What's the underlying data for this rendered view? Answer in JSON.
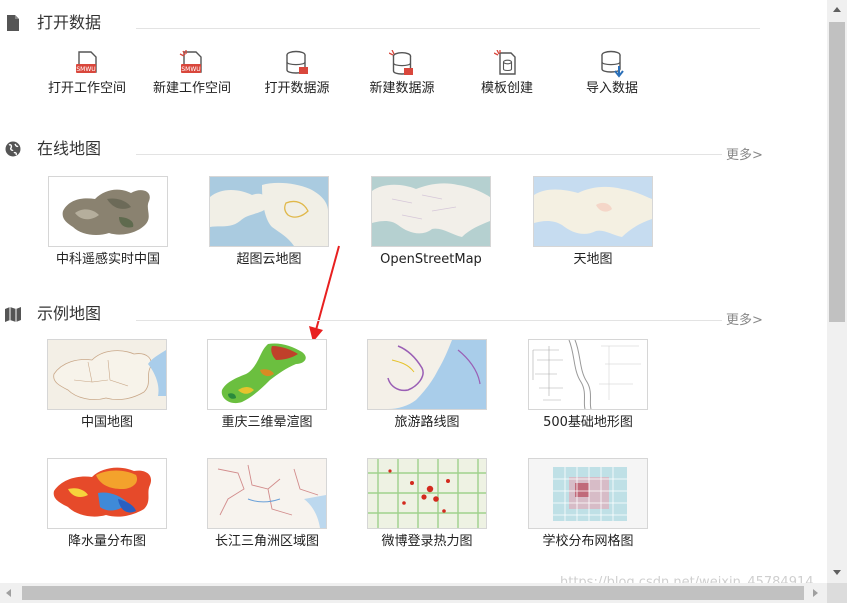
{
  "sections": {
    "open_data": {
      "title": "打开数据"
    },
    "online_maps": {
      "title": "在线地图",
      "more": "更多>"
    },
    "sample_maps": {
      "title": "示例地图",
      "more": "更多>"
    }
  },
  "open_data_items": [
    {
      "label": "打开工作空间",
      "icon": "open-workspace-icon"
    },
    {
      "label": "新建工作空间",
      "icon": "new-workspace-icon"
    },
    {
      "label": "打开数据源",
      "icon": "open-datasource-icon"
    },
    {
      "label": "新建数据源",
      "icon": "new-datasource-icon"
    },
    {
      "label": "模板创建",
      "icon": "template-create-icon"
    },
    {
      "label": "导入数据",
      "icon": "import-data-icon"
    }
  ],
  "online_maps": [
    {
      "label": "中科遥感实时中国"
    },
    {
      "label": "超图云地图"
    },
    {
      "label": "OpenStreetMap"
    },
    {
      "label": "天地图"
    }
  ],
  "sample_maps": [
    {
      "label": "中国地图"
    },
    {
      "label": "重庆三维晕渲图"
    },
    {
      "label": "旅游路线图"
    },
    {
      "label": "500基础地形图"
    },
    {
      "label": "降水量分布图"
    },
    {
      "label": "长江三角洲区域图"
    },
    {
      "label": "微博登录热力图"
    },
    {
      "label": "学校分布网格图"
    }
  ],
  "watermark": "https://blog.csdn.net/weixin_45784914",
  "colors": {
    "annotation_arrow": "#e82020",
    "icon_red": "#d9473c",
    "icon_gray": "#555555"
  }
}
